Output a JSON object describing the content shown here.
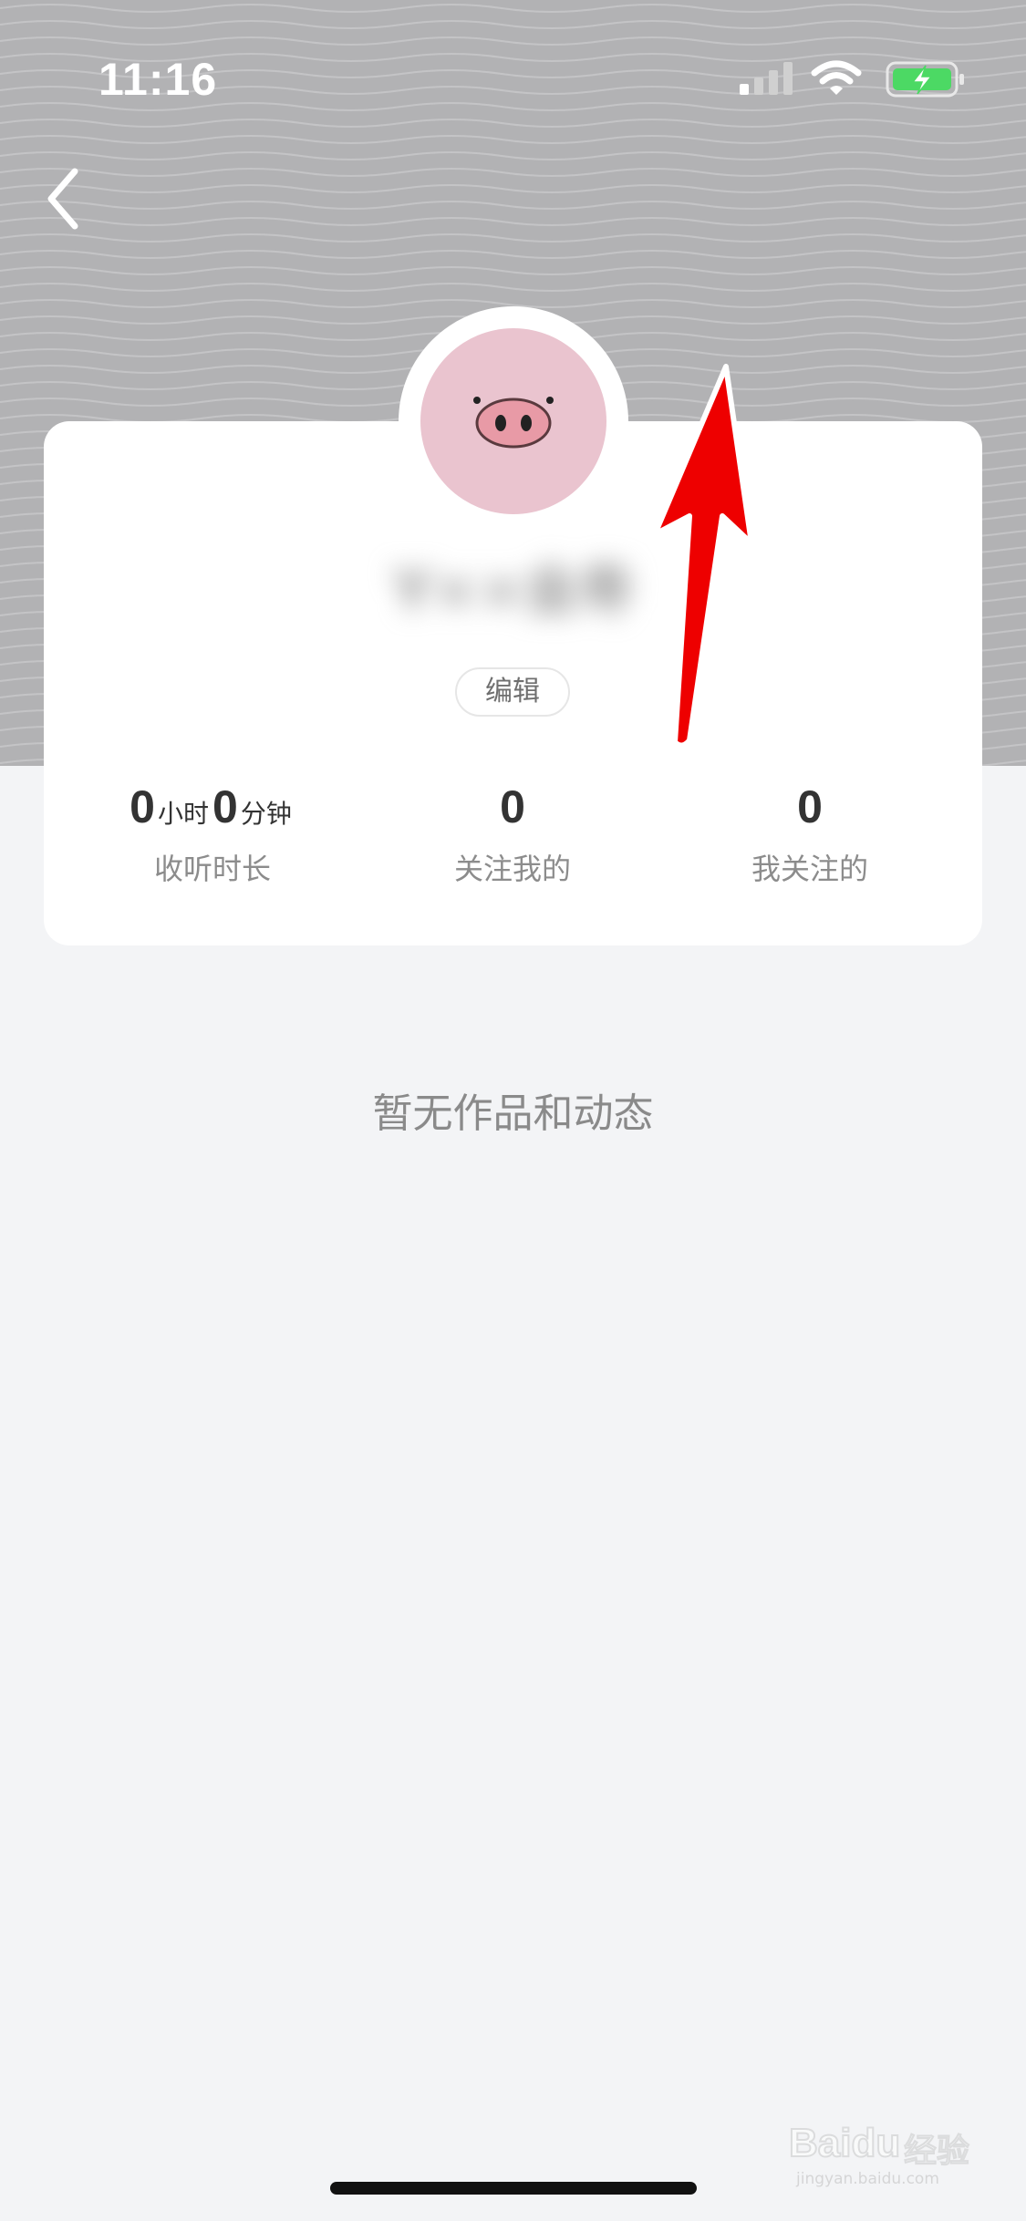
{
  "status_bar": {
    "time": "11:16",
    "signal_icon": "cellular-signal-icon",
    "wifi_icon": "wifi-icon",
    "battery_icon": "battery-charging-icon",
    "battery_color": "#4cd964"
  },
  "header": {
    "background_color": "#b2b2b4",
    "back_icon": "chevron-left-icon"
  },
  "profile": {
    "avatar_icon": "pig-face-icon",
    "avatar_color": "#eac4cf",
    "username": "Y××金寿",
    "edit_label": "编辑"
  },
  "stats": {
    "listening_time": {
      "hours": "0",
      "hours_unit": "小时",
      "minutes": "0",
      "minutes_unit": "分钟",
      "label": "收听时长"
    },
    "followers": {
      "value": "0",
      "label": "关注我的"
    },
    "following": {
      "value": "0",
      "label": "我关注的"
    }
  },
  "content": {
    "empty_message": "暂无作品和动态"
  },
  "annotation": {
    "arrow_color": "#ee0000"
  },
  "watermark": {
    "brand": "Baidu",
    "brand_cn": "经验",
    "url": "jingyan.baidu.com"
  }
}
